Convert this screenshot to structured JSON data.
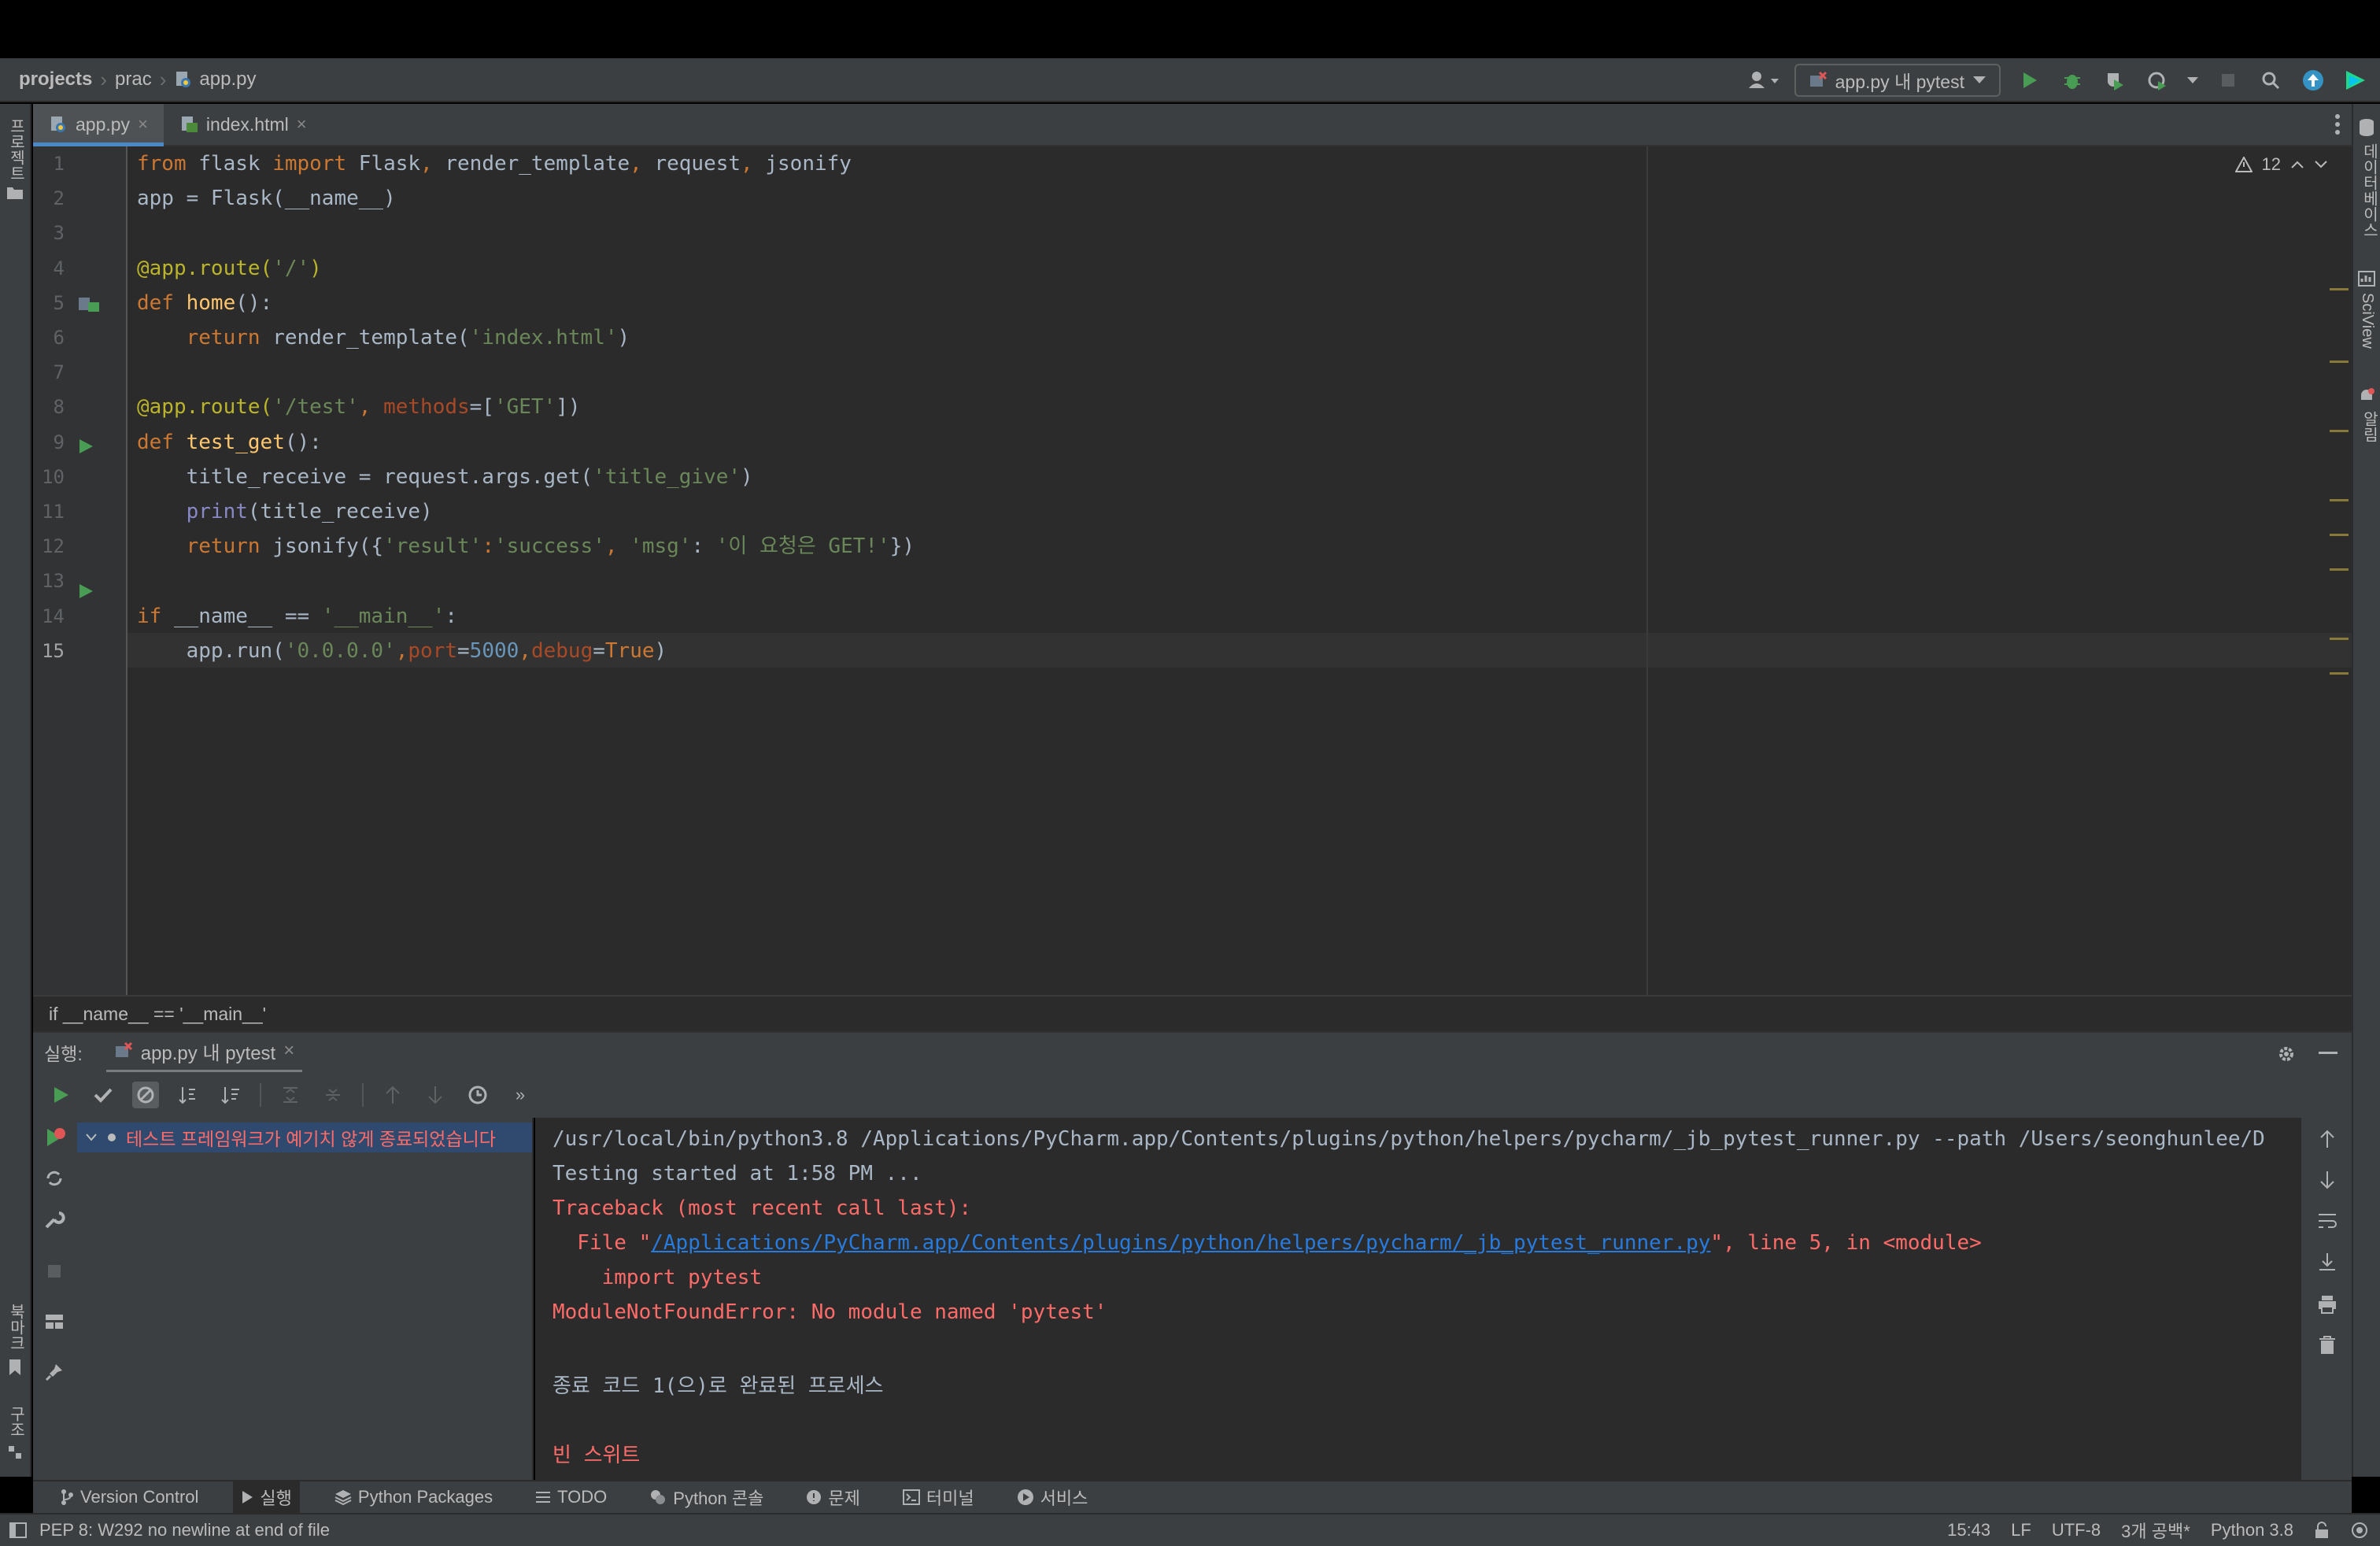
{
  "nav": {
    "crumbs": [
      "projects",
      "prac",
      "app.py"
    ],
    "run_config": "app.py 내 pytest"
  },
  "left_strip": {
    "project": "프로젝트",
    "bookmarks": "북마크",
    "structure": "구조"
  },
  "right_strip": {
    "database": "데이터베이스",
    "sciview": "SciView",
    "notifications": "알림"
  },
  "tabs": [
    {
      "label": "app.py",
      "active": true
    },
    {
      "label": "index.html",
      "active": false
    }
  ],
  "editor": {
    "inspections_count": "12",
    "line_numbers": [
      "1",
      "2",
      "3",
      "4",
      "5",
      "6",
      "7",
      "8",
      "9",
      "10",
      "11",
      "12",
      "13",
      "14",
      "15"
    ],
    "lines": [
      [
        [
          "kw",
          "from"
        ],
        [
          "plain",
          " flask "
        ],
        [
          "kw",
          "import"
        ],
        [
          "plain",
          " Flask"
        ],
        [
          "kw",
          ","
        ],
        [
          "plain",
          " render_template"
        ],
        [
          "kw",
          ","
        ],
        [
          "plain",
          " request"
        ],
        [
          "kw",
          ","
        ],
        [
          "plain",
          " jsonify"
        ]
      ],
      [
        [
          "plain",
          "app = Flask(__name__)"
        ]
      ],
      [],
      [
        [
          "dec",
          "@app.route("
        ],
        [
          "str",
          "'/'"
        ],
        [
          "dec",
          ")"
        ]
      ],
      [
        [
          "kw",
          "def "
        ],
        [
          "fn",
          "home"
        ],
        [
          "plain",
          "():"
        ]
      ],
      [
        [
          "plain",
          "    "
        ],
        [
          "kw",
          "return"
        ],
        [
          "plain",
          " render_template("
        ],
        [
          "str",
          "'index.html'"
        ],
        [
          "plain",
          ")"
        ]
      ],
      [],
      [
        [
          "dec",
          "@app.route("
        ],
        [
          "str",
          "'/test'"
        ],
        [
          "kw",
          ", "
        ],
        [
          "param",
          "methods"
        ],
        [
          "plain",
          "=["
        ],
        [
          "str",
          "'GET'"
        ],
        [
          "plain",
          "])"
        ]
      ],
      [
        [
          "kw",
          "def "
        ],
        [
          "fn",
          "test_get"
        ],
        [
          "plain",
          "():"
        ]
      ],
      [
        [
          "plain",
          "    title_receive = request.args.get("
        ],
        [
          "str",
          "'title_give'"
        ],
        [
          "plain",
          ")"
        ]
      ],
      [
        [
          "plain",
          "    "
        ],
        [
          "bi",
          "print"
        ],
        [
          "plain",
          "(title_receive)"
        ]
      ],
      [
        [
          "plain",
          "    "
        ],
        [
          "kw",
          "return"
        ],
        [
          "plain",
          " jsonify({"
        ],
        [
          "str",
          "'result'"
        ],
        [
          "kw",
          ":"
        ],
        [
          "str",
          "'success'"
        ],
        [
          "kw",
          ", "
        ],
        [
          "str",
          "'msg'"
        ],
        [
          "plain",
          ": "
        ],
        [
          "str",
          "'이 요청은 GET!'"
        ],
        [
          "plain",
          "})"
        ]
      ],
      [],
      [
        [
          "kw",
          "if"
        ],
        [
          "plain",
          " __name__ == "
        ],
        [
          "str",
          "'__main__'"
        ],
        [
          "plain",
          ":"
        ]
      ],
      [
        [
          "plain",
          "    app.run("
        ],
        [
          "str",
          "'0.0.0.0'"
        ],
        [
          "kw",
          ","
        ],
        [
          "param",
          "port"
        ],
        [
          "plain",
          "="
        ],
        [
          "num",
          "5000"
        ],
        [
          "kw",
          ","
        ],
        [
          "param",
          "debug"
        ],
        [
          "plain",
          "="
        ],
        [
          "kw",
          "True"
        ],
        [
          "plain",
          ")"
        ]
      ]
    ],
    "breadcrumb": "if __name__ == '__main__'"
  },
  "run_panel": {
    "label": "실행:",
    "tab": "app.py 내 pytest",
    "test_tree_item": "테스트 프레임워크가 예기치 않게 종료되었습니다",
    "console": {
      "cmd": "/usr/local/bin/python3.8 /Applications/PyCharm.app/Contents/plugins/python/helpers/pycharm/_jb_pytest_runner.py --path /Users/seonghunlee/D",
      "started": "Testing started at 1:58 PM ...",
      "traceback": "Traceback (most recent call last):",
      "file_prefix": "  File \"",
      "file_link": "/Applications/PyCharm.app/Contents/plugins/python/helpers/pycharm/_jb_pytest_runner.py",
      "file_suffix": "\", line 5, in <module>",
      "import_line": "    import pytest",
      "error": "ModuleNotFoundError: No module named 'pytest'",
      "exit": "종료 코드 1(으)로 완료된 프로세스",
      "empty_suite": "빈 스위트"
    }
  },
  "bottom_tools": {
    "version_control": "Version Control",
    "run": "실행",
    "python_packages": "Python Packages",
    "todo": "TODO",
    "python_console": "Python 콘솔",
    "problems": "문제",
    "terminal": "터미널",
    "services": "서비스"
  },
  "status": {
    "message": "PEP 8: W292 no newline at end of file",
    "position": "15:43",
    "line_sep": "LF",
    "encoding": "UTF-8",
    "indent": "3개 공백*",
    "interpreter": "Python 3.8"
  },
  "colors": {
    "accent": "#4a88c7",
    "error": "#ff6b68",
    "run_green": "#499c54"
  }
}
